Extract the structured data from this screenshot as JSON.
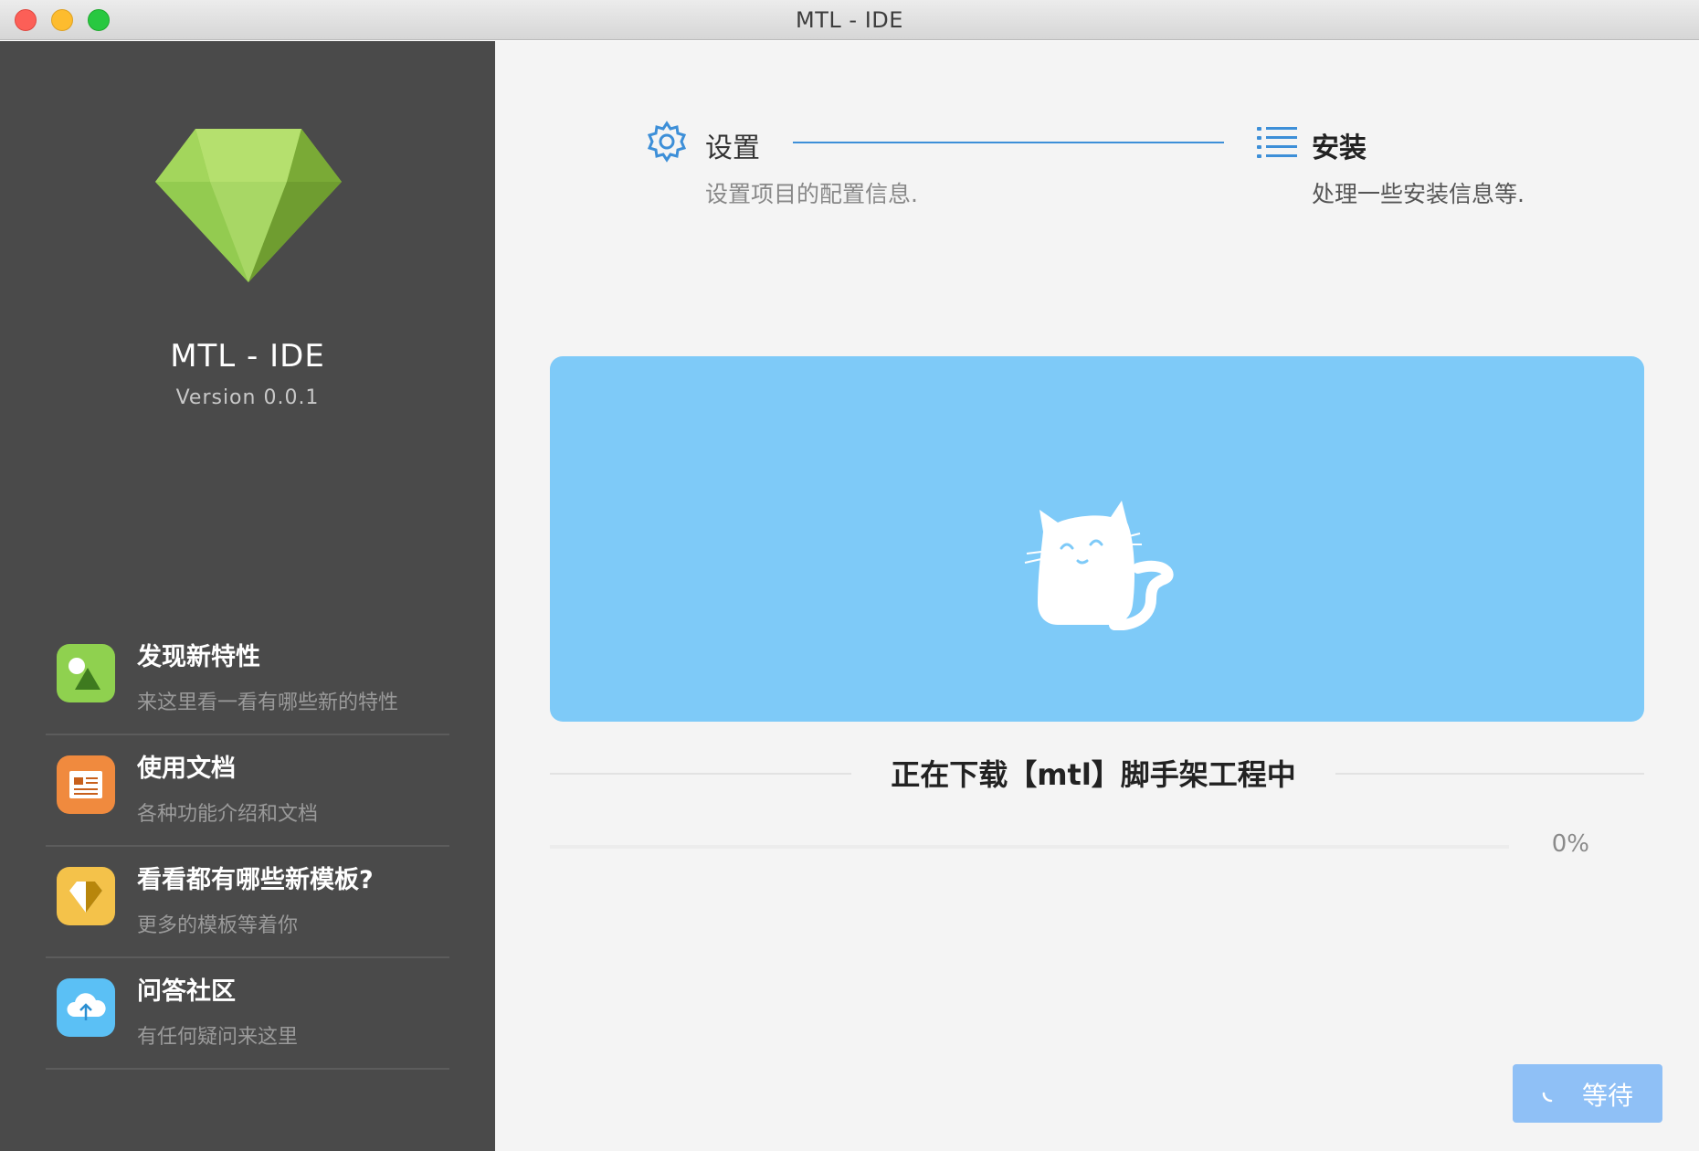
{
  "window": {
    "title": "MTL - IDE"
  },
  "sidebar": {
    "app_name": "MTL - IDE",
    "version": "Version 0.0.1",
    "items": [
      {
        "title": "发现新特性",
        "subtitle": "来这里看一看有哪些新的特性",
        "icon": "image-icon",
        "color": "#8fd14f"
      },
      {
        "title": "使用文档",
        "subtitle": "各种功能介绍和文档",
        "icon": "document-icon",
        "color": "#f08a3e"
      },
      {
        "title": "看看都有哪些新模板?",
        "subtitle": "更多的模板等着你",
        "icon": "gem-icon",
        "color": "#f4c24a"
      },
      {
        "title": "问答社区",
        "subtitle": "有任何疑问来这里",
        "icon": "cloud-upload-icon",
        "color": "#5bc0f5"
      }
    ]
  },
  "steps": [
    {
      "title": "设置",
      "description": "设置项目的配置信息.",
      "icon": "gear-icon"
    },
    {
      "title": "安装",
      "description": "处理一些安装信息等.",
      "icon": "list-icon"
    }
  ],
  "download": {
    "status": "正在下载【mtl】脚手架工程中",
    "progress_percent": 0,
    "progress_label": "0%"
  },
  "actions": {
    "wait_label": "等待"
  },
  "colors": {
    "accent": "#3d8fd8",
    "banner": "#7ecaf8",
    "sidebar_bg": "#4a4a4a",
    "main_bg": "#f4f4f4",
    "button_disabled": "#8fc0f6"
  }
}
